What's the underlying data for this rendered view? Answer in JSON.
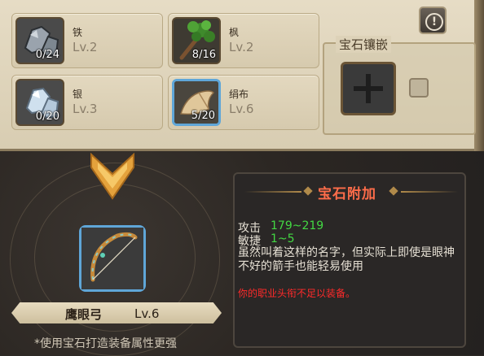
{
  "materials": [
    {
      "name": "铁",
      "level": "Lv.2",
      "count": "0/24",
      "icon": "iron-ore-icon"
    },
    {
      "name": "枫",
      "level": "Lv.2",
      "count": "8/16",
      "icon": "maple-branch-icon"
    },
    {
      "name": "银",
      "level": "Lv.3",
      "count": "0/20",
      "icon": "silver-ore-icon"
    },
    {
      "name": "绢布",
      "level": "Lv.6",
      "count": "5/20",
      "icon": "silk-cloth-icon"
    }
  ],
  "gem": {
    "title": "宝石镶嵌"
  },
  "info_button": {
    "symbol": "!"
  },
  "item": {
    "name": "鹰眼弓",
    "level": "Lv.6",
    "icon": "bow-icon"
  },
  "hint": "*使用宝石打造装备属性更强",
  "detail": {
    "title": "宝石附加",
    "stats": [
      {
        "label": "攻击",
        "value": "179~219"
      },
      {
        "label": "敏捷",
        "value": "1~5"
      }
    ],
    "description": "虽然叫着这样的名字，但实际上即使是眼神不好的箭手也能轻易使用",
    "warning": "你的职业头衔不足以装备。"
  },
  "colors": {
    "accent_red": "#ff6d4a",
    "stat_green": "#43d843",
    "warn_red": "#ff2a2a",
    "select_blue": "#5fa6d8"
  }
}
